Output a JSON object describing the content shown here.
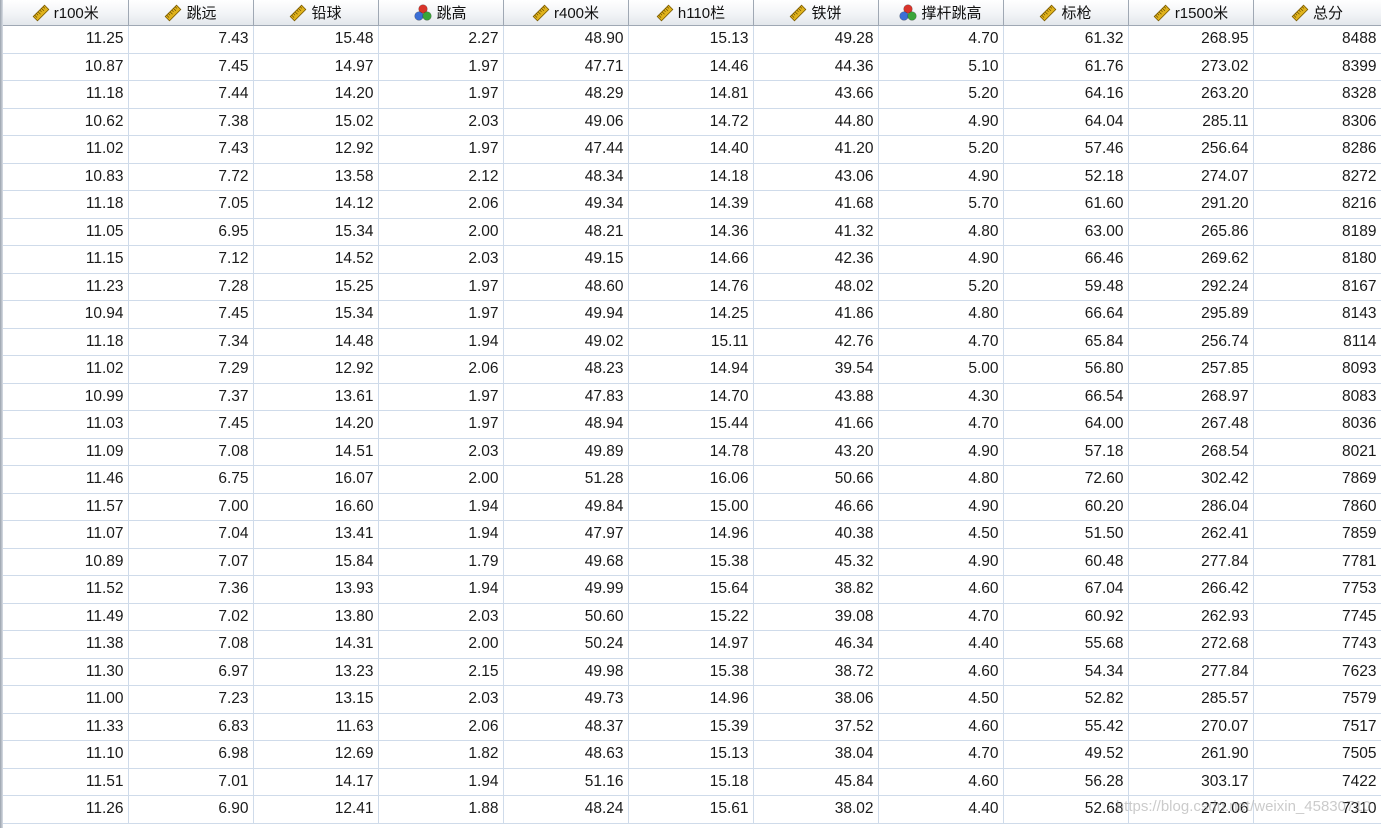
{
  "columns": [
    {
      "label": "r100米",
      "icon": "ruler-icon"
    },
    {
      "label": "跳远",
      "icon": "ruler-icon"
    },
    {
      "label": "铅球",
      "icon": "ruler-icon"
    },
    {
      "label": "跳高",
      "icon": "nominal-balls-icon"
    },
    {
      "label": "r400米",
      "icon": "ruler-icon"
    },
    {
      "label": "h110栏",
      "icon": "ruler-icon"
    },
    {
      "label": "铁饼",
      "icon": "ruler-icon"
    },
    {
      "label": "撑杆跳高",
      "icon": "nominal-balls-icon"
    },
    {
      "label": "标枪",
      "icon": "ruler-icon"
    },
    {
      "label": "r1500米",
      "icon": "ruler-icon"
    },
    {
      "label": "总分",
      "icon": "ruler-icon"
    }
  ],
  "rows": [
    [
      "11.25",
      "7.43",
      "15.48",
      "2.27",
      "48.90",
      "15.13",
      "49.28",
      "4.70",
      "61.32",
      "268.95",
      "8488"
    ],
    [
      "10.87",
      "7.45",
      "14.97",
      "1.97",
      "47.71",
      "14.46",
      "44.36",
      "5.10",
      "61.76",
      "273.02",
      "8399"
    ],
    [
      "11.18",
      "7.44",
      "14.20",
      "1.97",
      "48.29",
      "14.81",
      "43.66",
      "5.20",
      "64.16",
      "263.20",
      "8328"
    ],
    [
      "10.62",
      "7.38",
      "15.02",
      "2.03",
      "49.06",
      "14.72",
      "44.80",
      "4.90",
      "64.04",
      "285.11",
      "8306"
    ],
    [
      "11.02",
      "7.43",
      "12.92",
      "1.97",
      "47.44",
      "14.40",
      "41.20",
      "5.20",
      "57.46",
      "256.64",
      "8286"
    ],
    [
      "10.83",
      "7.72",
      "13.58",
      "2.12",
      "48.34",
      "14.18",
      "43.06",
      "4.90",
      "52.18",
      "274.07",
      "8272"
    ],
    [
      "11.18",
      "7.05",
      "14.12",
      "2.06",
      "49.34",
      "14.39",
      "41.68",
      "5.70",
      "61.60",
      "291.20",
      "8216"
    ],
    [
      "11.05",
      "6.95",
      "15.34",
      "2.00",
      "48.21",
      "14.36",
      "41.32",
      "4.80",
      "63.00",
      "265.86",
      "8189"
    ],
    [
      "11.15",
      "7.12",
      "14.52",
      "2.03",
      "49.15",
      "14.66",
      "42.36",
      "4.90",
      "66.46",
      "269.62",
      "8180"
    ],
    [
      "11.23",
      "7.28",
      "15.25",
      "1.97",
      "48.60",
      "14.76",
      "48.02",
      "5.20",
      "59.48",
      "292.24",
      "8167"
    ],
    [
      "10.94",
      "7.45",
      "15.34",
      "1.97",
      "49.94",
      "14.25",
      "41.86",
      "4.80",
      "66.64",
      "295.89",
      "8143"
    ],
    [
      "11.18",
      "7.34",
      "14.48",
      "1.94",
      "49.02",
      "15.11",
      "42.76",
      "4.70",
      "65.84",
      "256.74",
      "8114"
    ],
    [
      "11.02",
      "7.29",
      "12.92",
      "2.06",
      "48.23",
      "14.94",
      "39.54",
      "5.00",
      "56.80",
      "257.85",
      "8093"
    ],
    [
      "10.99",
      "7.37",
      "13.61",
      "1.97",
      "47.83",
      "14.70",
      "43.88",
      "4.30",
      "66.54",
      "268.97",
      "8083"
    ],
    [
      "11.03",
      "7.45",
      "14.20",
      "1.97",
      "48.94",
      "15.44",
      "41.66",
      "4.70",
      "64.00",
      "267.48",
      "8036"
    ],
    [
      "11.09",
      "7.08",
      "14.51",
      "2.03",
      "49.89",
      "14.78",
      "43.20",
      "4.90",
      "57.18",
      "268.54",
      "8021"
    ],
    [
      "11.46",
      "6.75",
      "16.07",
      "2.00",
      "51.28",
      "16.06",
      "50.66",
      "4.80",
      "72.60",
      "302.42",
      "7869"
    ],
    [
      "11.57",
      "7.00",
      "16.60",
      "1.94",
      "49.84",
      "15.00",
      "46.66",
      "4.90",
      "60.20",
      "286.04",
      "7860"
    ],
    [
      "11.07",
      "7.04",
      "13.41",
      "1.94",
      "47.97",
      "14.96",
      "40.38",
      "4.50",
      "51.50",
      "262.41",
      "7859"
    ],
    [
      "10.89",
      "7.07",
      "15.84",
      "1.79",
      "49.68",
      "15.38",
      "45.32",
      "4.90",
      "60.48",
      "277.84",
      "7781"
    ],
    [
      "11.52",
      "7.36",
      "13.93",
      "1.94",
      "49.99",
      "15.64",
      "38.82",
      "4.60",
      "67.04",
      "266.42",
      "7753"
    ],
    [
      "11.49",
      "7.02",
      "13.80",
      "2.03",
      "50.60",
      "15.22",
      "39.08",
      "4.70",
      "60.92",
      "262.93",
      "7745"
    ],
    [
      "11.38",
      "7.08",
      "14.31",
      "2.00",
      "50.24",
      "14.97",
      "46.34",
      "4.40",
      "55.68",
      "272.68",
      "7743"
    ],
    [
      "11.30",
      "6.97",
      "13.23",
      "2.15",
      "49.98",
      "15.38",
      "38.72",
      "4.60",
      "54.34",
      "277.84",
      "7623"
    ],
    [
      "11.00",
      "7.23",
      "13.15",
      "2.03",
      "49.73",
      "14.96",
      "38.06",
      "4.50",
      "52.82",
      "285.57",
      "7579"
    ],
    [
      "11.33",
      "6.83",
      "11.63",
      "2.06",
      "48.37",
      "15.39",
      "37.52",
      "4.60",
      "55.42",
      "270.07",
      "7517"
    ],
    [
      "11.10",
      "6.98",
      "12.69",
      "1.82",
      "48.63",
      "15.13",
      "38.04",
      "4.70",
      "49.52",
      "261.90",
      "7505"
    ],
    [
      "11.51",
      "7.01",
      "14.17",
      "1.94",
      "51.16",
      "15.18",
      "45.84",
      "4.60",
      "56.28",
      "303.17",
      "7422"
    ],
    [
      "11.26",
      "6.90",
      "12.41",
      "1.88",
      "48.24",
      "15.61",
      "38.02",
      "4.40",
      "52.68",
      "272.06",
      "7310"
    ]
  ],
  "watermark": "https://blog.csdn.net/weixin_45830710",
  "colors": {
    "header_top": "#ffffff",
    "header_bottom": "#e3e7ec",
    "grid_line": "#cfdbea",
    "ruler_icon": "#e0b31c",
    "ball_red": "#d9342b",
    "ball_green": "#3aa53a",
    "ball_blue": "#3b6fd6"
  }
}
